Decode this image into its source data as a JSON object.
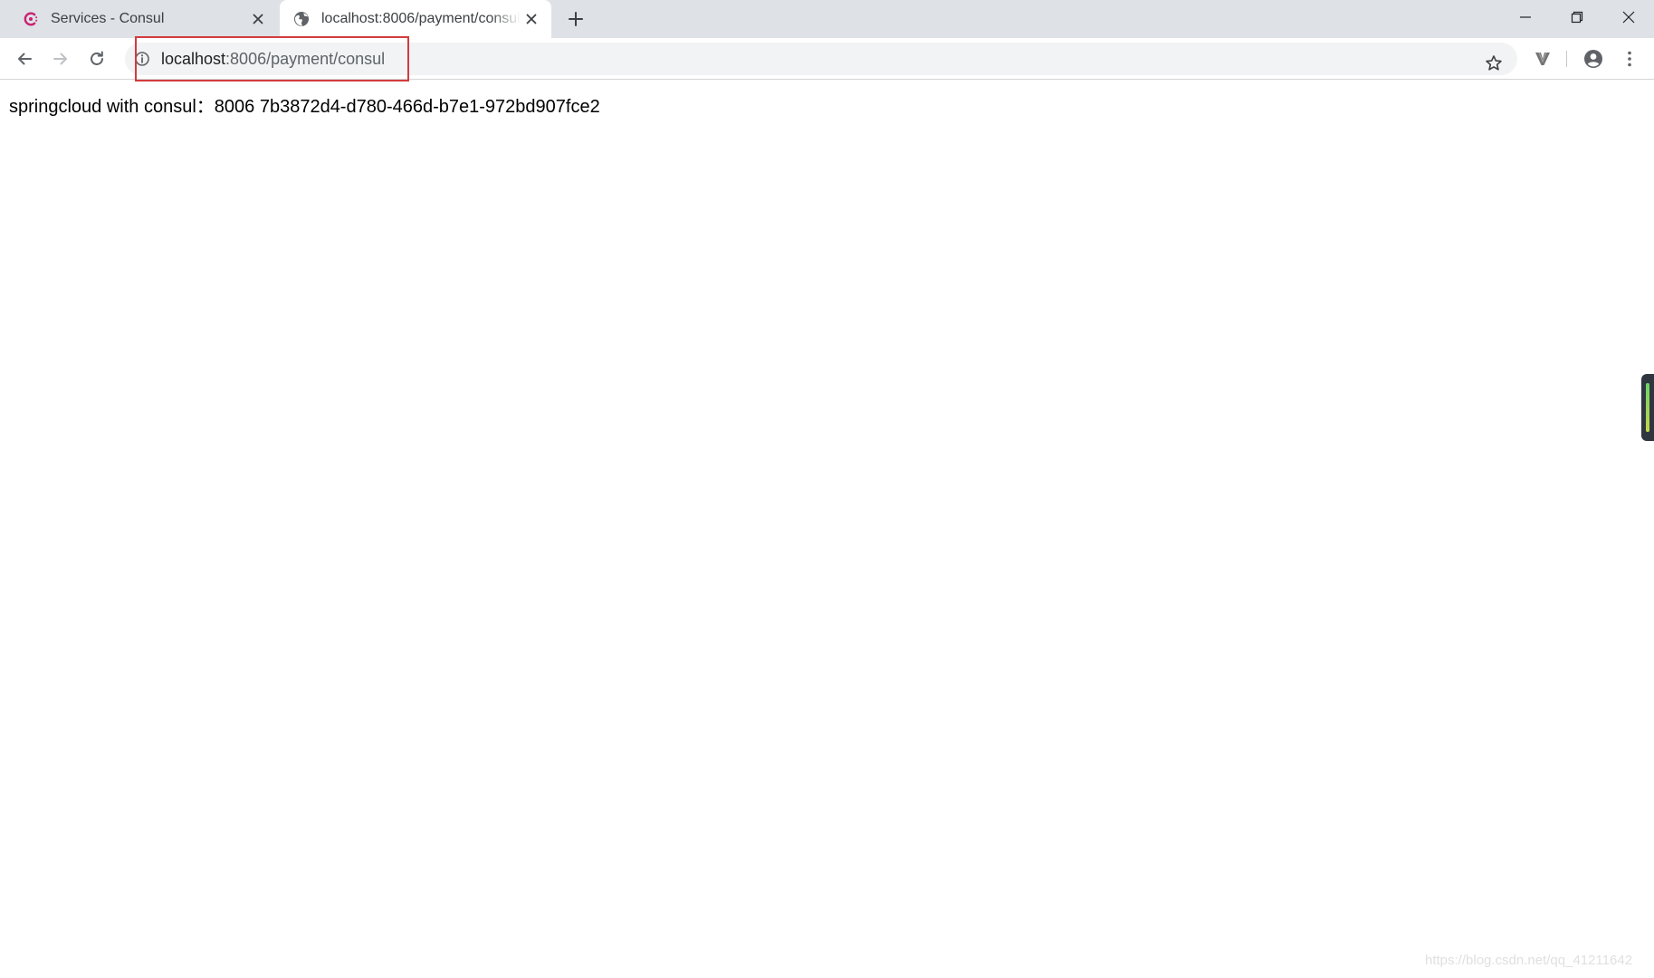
{
  "tabs": [
    {
      "title": "Services - Consul",
      "favicon": "consul-logo-icon",
      "active": false
    },
    {
      "title": "localhost:8006/payment/consul",
      "favicon": "globe-icon",
      "active": true
    }
  ],
  "address_bar": {
    "host": "localhost",
    "path": ":8006/payment/consul"
  },
  "page": {
    "body_text": "springcloud with consul：8006 7b3872d4-d780-466d-b7e1-972bd907fce2"
  },
  "watermark": "https://blog.csdn.net/qq_41211642",
  "colors": {
    "highlight_box": "#d23c3c",
    "consul_brand": "#ca2171"
  }
}
